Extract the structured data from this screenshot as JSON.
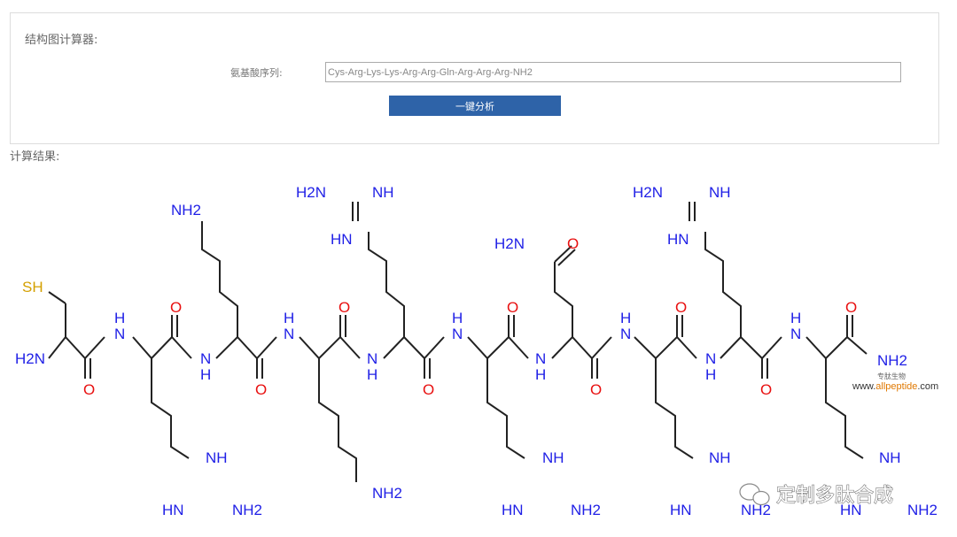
{
  "calculator": {
    "title": "结构图计算器:",
    "sequence_label": "氨基酸序列:",
    "sequence_value": "Cys-Arg-Lys-Lys-Arg-Arg-Gln-Arg-Arg-Arg-NH2",
    "analyze_button": "一键分析"
  },
  "results": {
    "label": "计算结果:"
  },
  "structure": {
    "atoms": {
      "sh": "SH",
      "h2n": "H2N",
      "n": "N",
      "h": "H",
      "o": "O",
      "nh2": "NH2",
      "nh": "NH",
      "hn": "HN",
      "h2n_amide": "H2N"
    },
    "watermark": {
      "cn": "专肽生物",
      "url_prefix": "www.",
      "url_brand": "allpeptide",
      "url_suffix": ".com"
    },
    "overlay": {
      "channel": "定制多肽合成"
    }
  }
}
